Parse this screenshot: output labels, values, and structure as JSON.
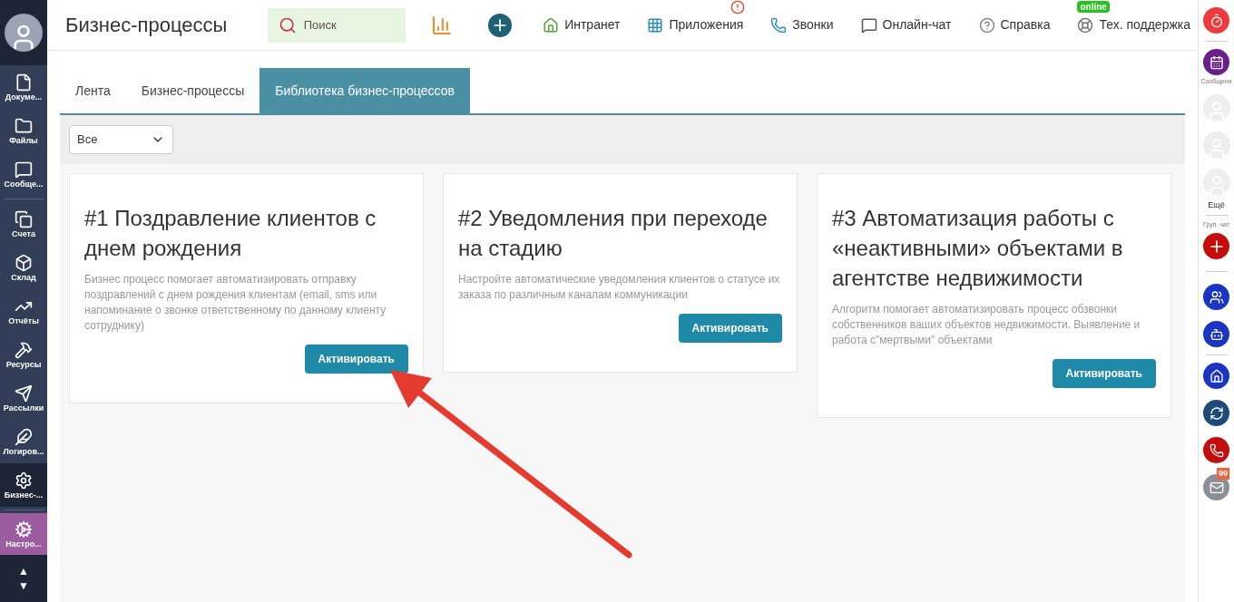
{
  "sidebar": {
    "items": [
      {
        "label": "Докуме...",
        "selected": false
      },
      {
        "label": "Файлы",
        "selected": false
      },
      {
        "label": "Сообще...",
        "selected": false
      },
      {
        "label": "Счета",
        "selected": false
      },
      {
        "label": "Склад",
        "selected": false
      },
      {
        "label": "Отчёты",
        "selected": false
      },
      {
        "label": "Ресурсы",
        "selected": false
      },
      {
        "label": "Рассылки",
        "selected": false
      },
      {
        "label": "Логиров...",
        "selected": false
      },
      {
        "label": "Бизнес-...",
        "selected": true
      }
    ],
    "settings_item": {
      "label": "Настро..."
    },
    "scroll_up": "▲",
    "scroll_down": "▼"
  },
  "header": {
    "title": "Бизнес-процессы",
    "search": {
      "placeholder": "Поиск"
    },
    "nav": [
      {
        "label": "Интранет"
      },
      {
        "label": "Приложения",
        "alert": true
      },
      {
        "label": "Звонки"
      },
      {
        "label": "Онлайн-чат"
      },
      {
        "label": "Справка"
      },
      {
        "label": "Тех. поддержка",
        "badge": "online"
      }
    ]
  },
  "tabs": [
    {
      "label": "Лента",
      "selected": false
    },
    {
      "label": "Бизнес-процессы",
      "selected": false
    },
    {
      "label": "Библиотека бизнес-процессов",
      "selected": true
    }
  ],
  "filter": {
    "value": "Все"
  },
  "cards": [
    {
      "title": "#1 Поздравление клиентов с днем рождения",
      "description": "Бизнес процесс помогает автоматизировать отправку поздравлений с днем рождения клиентам (email, sms или напоминание о звонке ответственному по данному клиенту сотруднику)",
      "button": "Активировать"
    },
    {
      "title": "#2 Уведомления при переходе на стадию",
      "description": "Настройте автоматические уведомления клиентов о статусе их заказа по различным каналам коммуникации",
      "button": "Активировать"
    },
    {
      "title": "#3 Автоматизация работы с «неактивными» объектами в агентстве недвижимости",
      "description": "Алгоритм помогает автоматизировать процесс обзвонки собственников ваших объектов недвижимости. Выявление и работа с\"мертвыми\" объектами",
      "button": "Активировать"
    }
  ],
  "right_bar": {
    "messages_label": "Сообщени",
    "more_label": "Ещё",
    "group_chat_label": "Груп. чат",
    "mail_badge": "99"
  }
}
